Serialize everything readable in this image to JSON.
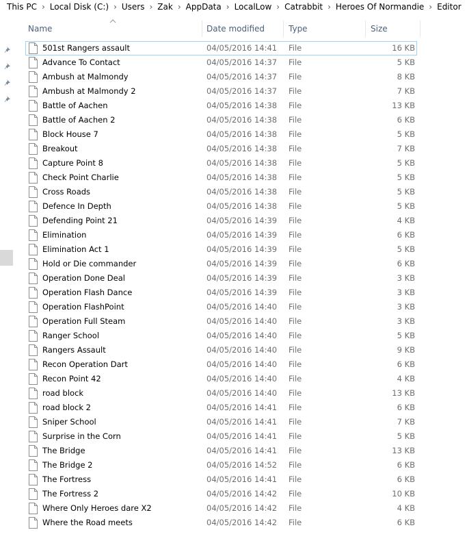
{
  "breadcrumb": [
    "This PC",
    "Local Disk (C:)",
    "Users",
    "Zak",
    "AppData",
    "LocalLow",
    "Catrabbit",
    "Heroes Of Normandie",
    "Editor"
  ],
  "columns": {
    "name": "Name",
    "date": "Date modified",
    "type": "Type",
    "size": "Size"
  },
  "sort": {
    "column": "Name",
    "direction": "ascending"
  },
  "colors": {
    "selection_border": "#99d1ff",
    "header_text": "#4c607a",
    "detail_text": "#6d6d6d"
  },
  "files": [
    {
      "name": "501st Rangers assault",
      "date": "04/05/2016 14:41",
      "type": "File",
      "size": "16 KB",
      "selected": true
    },
    {
      "name": "Advance To Contact",
      "date": "04/05/2016 14:37",
      "type": "File",
      "size": "5 KB"
    },
    {
      "name": "Ambush at Malmondy",
      "date": "04/05/2016 14:37",
      "type": "File",
      "size": "8 KB"
    },
    {
      "name": "Ambush at Malmondy 2",
      "date": "04/05/2016 14:37",
      "type": "File",
      "size": "7 KB"
    },
    {
      "name": "Battle of Aachen",
      "date": "04/05/2016 14:38",
      "type": "File",
      "size": "13 KB"
    },
    {
      "name": "Battle of Aachen 2",
      "date": "04/05/2016 14:38",
      "type": "File",
      "size": "6 KB"
    },
    {
      "name": "Block House 7",
      "date": "04/05/2016 14:38",
      "type": "File",
      "size": "5 KB"
    },
    {
      "name": "Breakout",
      "date": "04/05/2016 14:38",
      "type": "File",
      "size": "7 KB"
    },
    {
      "name": "Capture Point 8",
      "date": "04/05/2016 14:38",
      "type": "File",
      "size": "5 KB"
    },
    {
      "name": "Check Point Charlie",
      "date": "04/05/2016 14:38",
      "type": "File",
      "size": "5 KB"
    },
    {
      "name": "Cross Roads",
      "date": "04/05/2016 14:38",
      "type": "File",
      "size": "5 KB"
    },
    {
      "name": "Defence In Depth",
      "date": "04/05/2016 14:38",
      "type": "File",
      "size": "5 KB"
    },
    {
      "name": "Defending Point 21",
      "date": "04/05/2016 14:39",
      "type": "File",
      "size": "4 KB"
    },
    {
      "name": "Elimination",
      "date": "04/05/2016 14:39",
      "type": "File",
      "size": "6 KB"
    },
    {
      "name": "Elimination Act 1",
      "date": "04/05/2016 14:39",
      "type": "File",
      "size": "5 KB"
    },
    {
      "name": "Hold or Die commander",
      "date": "04/05/2016 14:39",
      "type": "File",
      "size": "6 KB"
    },
    {
      "name": "Operation Done Deal",
      "date": "04/05/2016 14:39",
      "type": "File",
      "size": "3 KB"
    },
    {
      "name": "Operation Flash Dance",
      "date": "04/05/2016 14:39",
      "type": "File",
      "size": "3 KB"
    },
    {
      "name": "Operation FlashPoint",
      "date": "04/05/2016 14:40",
      "type": "File",
      "size": "3 KB"
    },
    {
      "name": "Operation Full Steam",
      "date": "04/05/2016 14:40",
      "type": "File",
      "size": "3 KB"
    },
    {
      "name": "Ranger School",
      "date": "04/05/2016 14:40",
      "type": "File",
      "size": "5 KB"
    },
    {
      "name": "Rangers Assault",
      "date": "04/05/2016 14:40",
      "type": "File",
      "size": "9 KB"
    },
    {
      "name": "Recon Operation Dart",
      "date": "04/05/2016 14:40",
      "type": "File",
      "size": "6 KB"
    },
    {
      "name": "Recon Point 42",
      "date": "04/05/2016 14:40",
      "type": "File",
      "size": "4 KB"
    },
    {
      "name": "road block",
      "date": "04/05/2016 14:40",
      "type": "File",
      "size": "13 KB"
    },
    {
      "name": "road block 2",
      "date": "04/05/2016 14:41",
      "type": "File",
      "size": "6 KB"
    },
    {
      "name": "Sniper School",
      "date": "04/05/2016 14:41",
      "type": "File",
      "size": "7 KB"
    },
    {
      "name": "Surprise in the Corn",
      "date": "04/05/2016 14:41",
      "type": "File",
      "size": "5 KB"
    },
    {
      "name": "The Bridge",
      "date": "04/05/2016 14:41",
      "type": "File",
      "size": "13 KB"
    },
    {
      "name": "The Bridge 2",
      "date": "04/05/2016 14:52",
      "type": "File",
      "size": "6 KB"
    },
    {
      "name": "The Fortress",
      "date": "04/05/2016 14:41",
      "type": "File",
      "size": "6 KB"
    },
    {
      "name": "The Fortress 2",
      "date": "04/05/2016 14:42",
      "type": "File",
      "size": "10 KB"
    },
    {
      "name": "Where Only Heroes dare X2",
      "date": "04/05/2016 14:42",
      "type": "File",
      "size": "4 KB"
    },
    {
      "name": "Where the Road meets",
      "date": "04/05/2016 14:42",
      "type": "File",
      "size": "6 KB"
    }
  ]
}
